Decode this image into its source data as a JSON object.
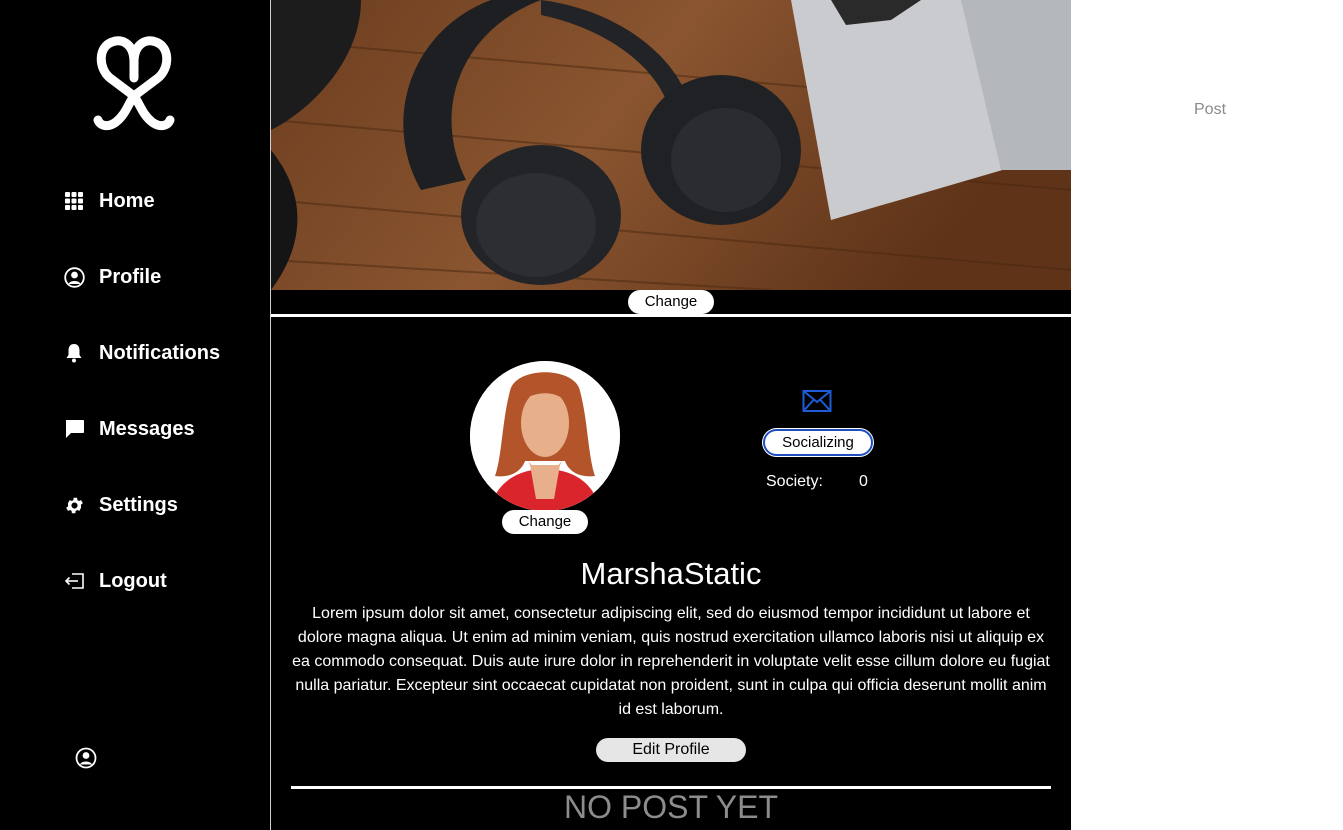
{
  "sidebar": {
    "items": [
      {
        "label": "Home",
        "icon": "grid-icon"
      },
      {
        "label": "Profile",
        "icon": "user-circle-icon"
      },
      {
        "label": "Notifications",
        "icon": "bell-icon"
      },
      {
        "label": "Messages",
        "icon": "message-icon"
      },
      {
        "label": "Settings",
        "icon": "gear-icon"
      },
      {
        "label": "Logout",
        "icon": "logout-icon"
      }
    ]
  },
  "cover": {
    "change_label": "Change"
  },
  "profile": {
    "avatar_change_label": "Change",
    "status_label": "Socializing",
    "society_label": "Society:",
    "society_count": "0",
    "username": "MarshaStatic",
    "bio": "Lorem ipsum dolor sit amet, consectetur adipiscing elit, sed do eiusmod tempor incididunt ut labore et dolore magna aliqua. Ut enim ad minim veniam, quis nostrud exercitation ullamco laboris nisi ut aliquip ex ea commodo consequat. Duis aute irure dolor in reprehenderit in voluptate velit esse cillum dolore eu fugiat nulla pariatur. Excepteur sint occaecat cupidatat non proident, sunt in culpa qui officia deserunt mollit anim id est laborum.",
    "edit_label": "Edit Profile",
    "empty_posts": "NO POST YET"
  },
  "right_panel": {
    "post_label": "Post"
  },
  "colors": {
    "background": "#000000",
    "accent": "#1f4fbf",
    "muted": "#8c8c8c"
  }
}
